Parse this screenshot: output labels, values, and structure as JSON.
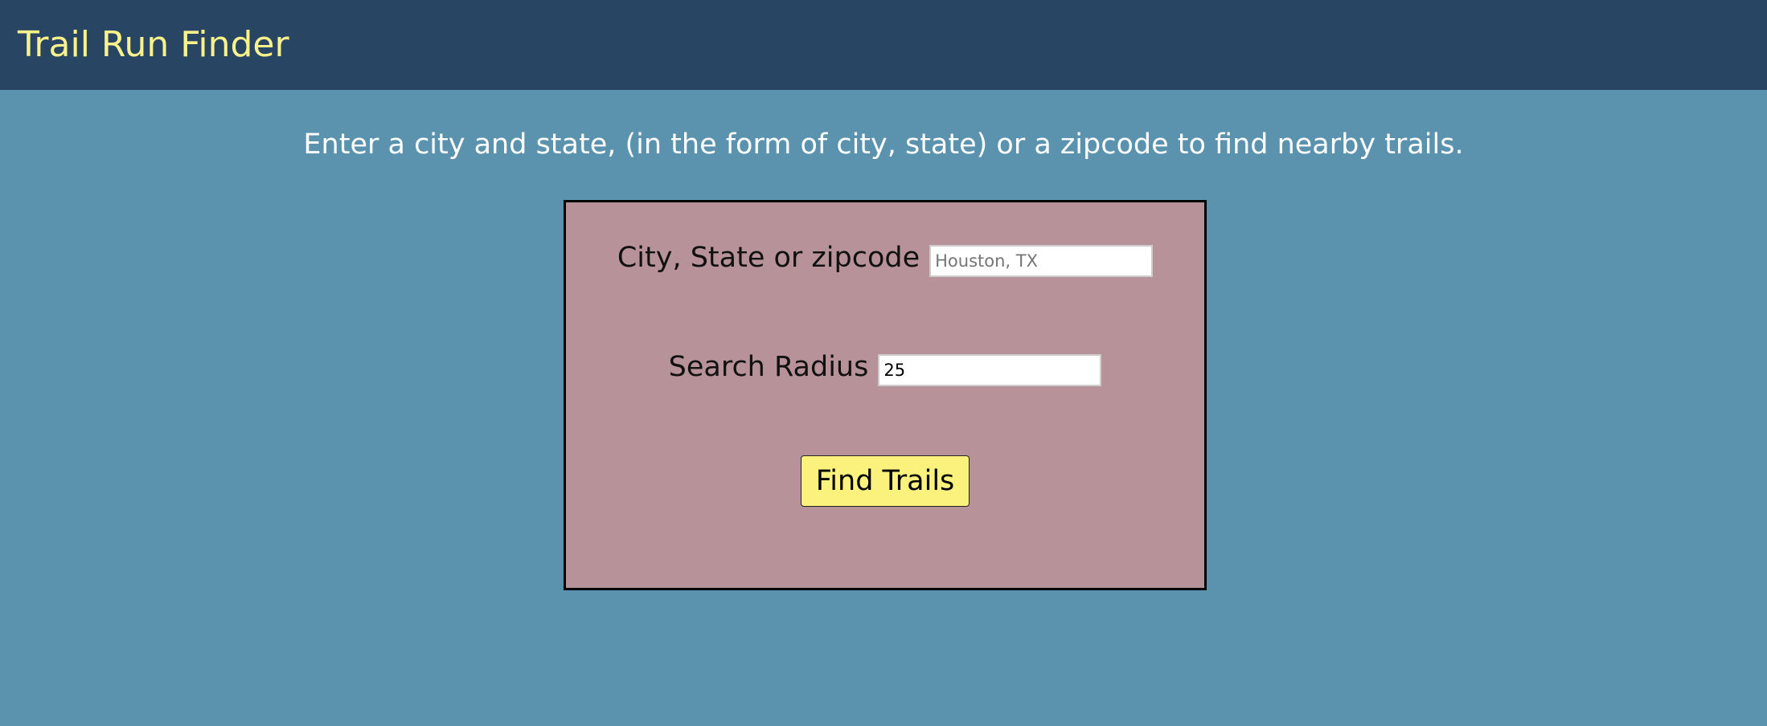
{
  "header": {
    "title": "Trail Run Finder"
  },
  "main": {
    "instructions": "Enter a city and state, (in the form of city, state) or a zipcode to find nearby trails."
  },
  "form": {
    "location_label": "City, State or zipcode",
    "location_placeholder": "Houston, TX",
    "location_value": "",
    "radius_label": "Search Radius",
    "radius_value": "25",
    "submit_label": "Find Trails"
  },
  "colors": {
    "header_bg": "#284664",
    "page_bg": "#5b93ae",
    "title_text": "#fbf28b",
    "form_bg": "#b79399",
    "button_bg": "#fbf27e"
  }
}
